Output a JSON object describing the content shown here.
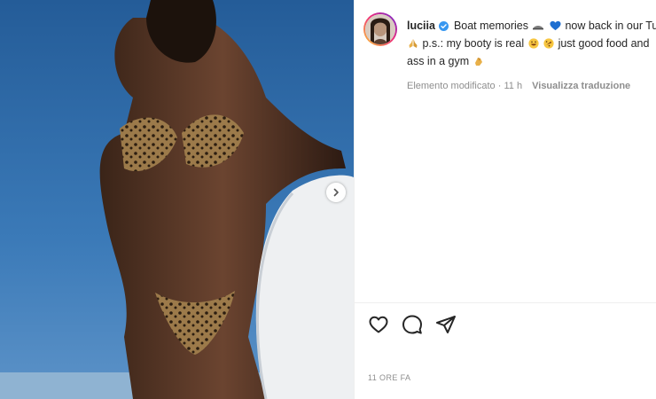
{
  "post": {
    "username": "luciia",
    "caption_line1": "Boat memories",
    "caption_line1_rest": "now back in our Tul",
    "caption_line2_a": "p.s.: my booty is real",
    "caption_line2_b": "just good food and",
    "caption_line3": "ass in a gym",
    "edited_label": "Elemento modificato",
    "time_short": "11 h",
    "translate_label": "Visualizza traduzione",
    "timestamp": "11 ORE FA"
  },
  "icons": {
    "verified": "verified-badge-icon",
    "like": "heart-icon",
    "comment": "comment-icon",
    "share": "paper-plane-icon",
    "next": "chevron-right-icon"
  },
  "colors": {
    "verified_blue": "#3897f0",
    "sky": "#2e6aa8",
    "text_primary": "#262626",
    "text_secondary": "#8e8e8e"
  }
}
